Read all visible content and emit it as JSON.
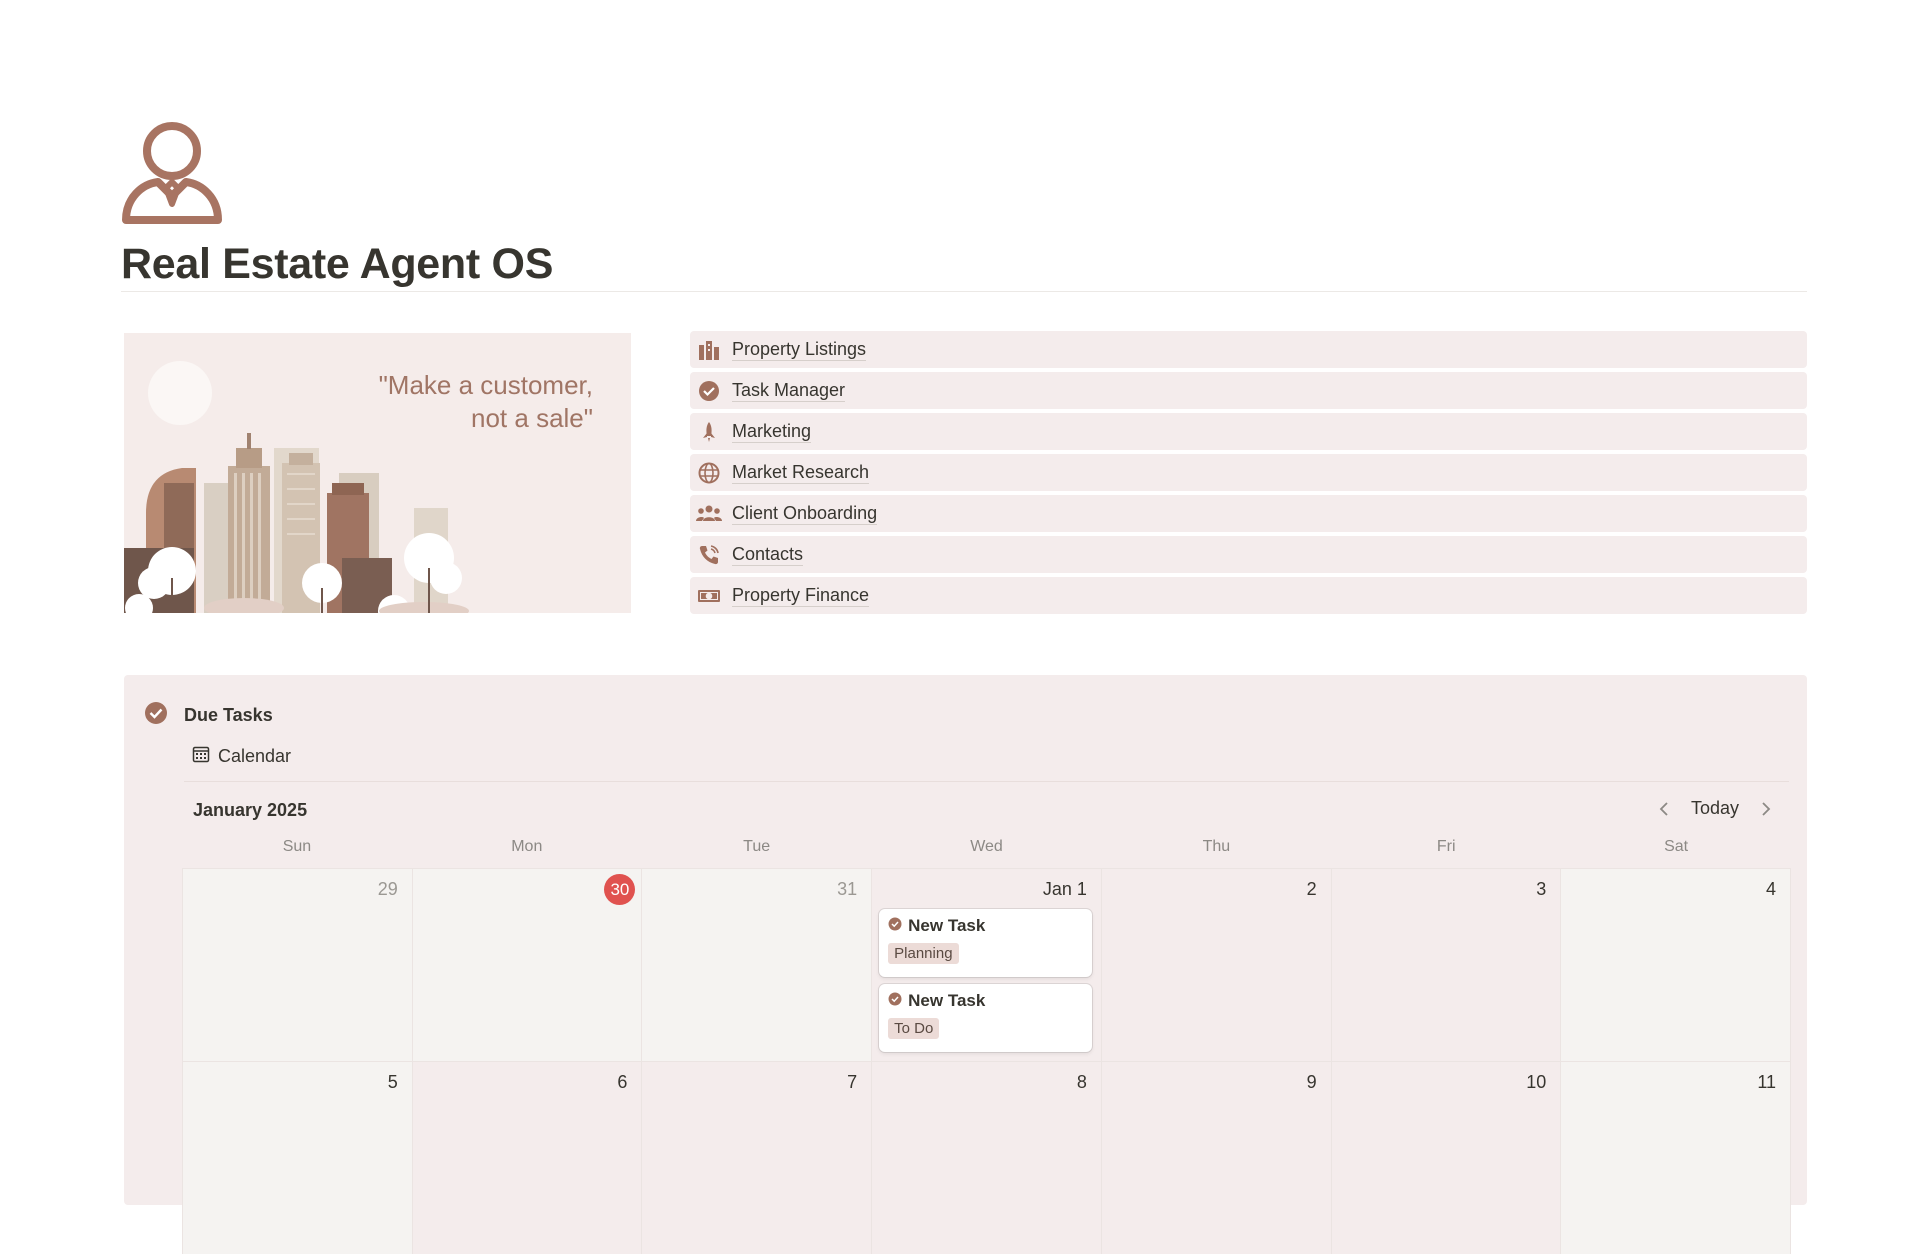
{
  "page": {
    "title": "Real Estate Agent OS",
    "icon": "businessman-icon"
  },
  "banner": {
    "quote_line1": "\"Make a customer,",
    "quote_line2": "not a sale\""
  },
  "nav_items": [
    {
      "label": "Property Listings",
      "icon": "buildings-icon"
    },
    {
      "label": "Task Manager",
      "icon": "check-circle-icon"
    },
    {
      "label": "Marketing",
      "icon": "rocket-icon"
    },
    {
      "label": "Market Research",
      "icon": "globe-icon"
    },
    {
      "label": "Client Onboarding",
      "icon": "people-icon"
    },
    {
      "label": "Contacts",
      "icon": "phone-icon"
    },
    {
      "label": "Property Finance",
      "icon": "money-icon"
    }
  ],
  "due_tasks": {
    "heading": "Due Tasks",
    "view_tab": "Calendar",
    "month": "January 2025",
    "today_label": "Today",
    "weekdays": [
      "Sun",
      "Mon",
      "Tue",
      "Wed",
      "Thu",
      "Fri",
      "Sat"
    ],
    "week1": [
      "29",
      "30",
      "31",
      "Jan 1",
      "2",
      "3",
      "4"
    ],
    "week2": [
      "5",
      "6",
      "7",
      "8",
      "9",
      "10",
      "11"
    ],
    "today_date": "30",
    "tasks": [
      {
        "title": "New Task",
        "tag": "Planning"
      },
      {
        "title": "New Task",
        "tag": "To Do"
      }
    ]
  },
  "colors": {
    "accent": "#a0705e",
    "callout_bg": "#f4ecec",
    "today_badge": "#e0524f"
  }
}
